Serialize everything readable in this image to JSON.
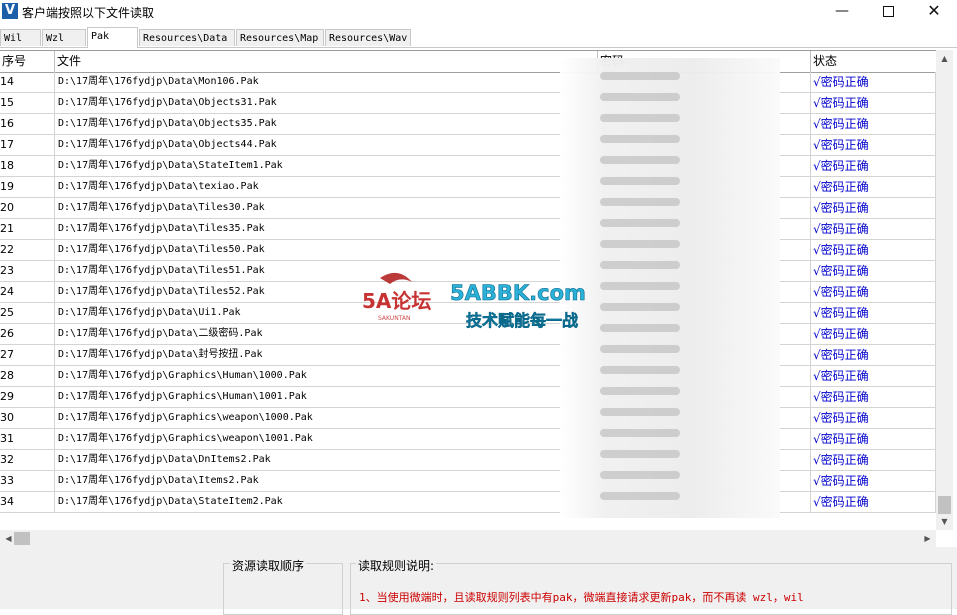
{
  "window": {
    "title": "客户端按照以下文件读取",
    "app_icon": "V",
    "min_icon": "minimize-icon",
    "max_icon": "maximize-icon",
    "close_icon": "close-icon"
  },
  "tabs": [
    {
      "label": "Wil"
    },
    {
      "label": "Wzl"
    },
    {
      "label": "Pak"
    },
    {
      "label": "Resources\\Data"
    },
    {
      "label": "Resources\\Map"
    },
    {
      "label": "Resources\\Wav"
    }
  ],
  "active_tab": "Pak",
  "table": {
    "headers": {
      "no": "序号",
      "file": "文件",
      "password": "密码",
      "status": "状态"
    },
    "rows": [
      {
        "no": "14",
        "file": "D:\\17周年\\176fydjp\\Data\\Mon106.Pak",
        "status": "√密码正确"
      },
      {
        "no": "15",
        "file": "D:\\17周年\\176fydjp\\Data\\Objects31.Pak",
        "status": "√密码正确"
      },
      {
        "no": "16",
        "file": "D:\\17周年\\176fydjp\\Data\\Objects35.Pak",
        "status": "√密码正确"
      },
      {
        "no": "17",
        "file": "D:\\17周年\\176fydjp\\Data\\Objects44.Pak",
        "status": "√密码正确"
      },
      {
        "no": "18",
        "file": "D:\\17周年\\176fydjp\\Data\\StateItem1.Pak",
        "status": "√密码正确"
      },
      {
        "no": "19",
        "file": "D:\\17周年\\176fydjp\\Data\\texiao.Pak",
        "status": "√密码正确"
      },
      {
        "no": "20",
        "file": "D:\\17周年\\176fydjp\\Data\\Tiles30.Pak",
        "status": "√密码正确"
      },
      {
        "no": "21",
        "file": "D:\\17周年\\176fydjp\\Data\\Tiles35.Pak",
        "status": "√密码正确"
      },
      {
        "no": "22",
        "file": "D:\\17周年\\176fydjp\\Data\\Tiles50.Pak",
        "status": "√密码正确"
      },
      {
        "no": "23",
        "file": "D:\\17周年\\176fydjp\\Data\\Tiles51.Pak",
        "status": "√密码正确"
      },
      {
        "no": "24",
        "file": "D:\\17周年\\176fydjp\\Data\\Tiles52.Pak",
        "status": "√密码正确"
      },
      {
        "no": "25",
        "file": "D:\\17周年\\176fydjp\\Data\\Ui1.Pak",
        "status": "√密码正确"
      },
      {
        "no": "26",
        "file": "D:\\17周年\\176fydjp\\Data\\二级密码.Pak",
        "status": "√密码正确"
      },
      {
        "no": "27",
        "file": "D:\\17周年\\176fydjp\\Data\\封号按扭.Pak",
        "status": "√密码正确"
      },
      {
        "no": "28",
        "file": "D:\\17周年\\176fydjp\\Graphics\\Human\\1000.Pak",
        "status": "√密码正确"
      },
      {
        "no": "29",
        "file": "D:\\17周年\\176fydjp\\Graphics\\Human\\1001.Pak",
        "status": "√密码正确"
      },
      {
        "no": "30",
        "file": "D:\\17周年\\176fydjp\\Graphics\\weapon\\1000.Pak",
        "status": "√密码正确"
      },
      {
        "no": "31",
        "file": "D:\\17周年\\176fydjp\\Graphics\\weapon\\1001.Pak",
        "status": "√密码正确"
      },
      {
        "no": "32",
        "file": "D:\\17周年\\176fydjp\\Data\\DnItems2.Pak",
        "status": "√密码正确"
      },
      {
        "no": "33",
        "file": "D:\\17周年\\176fydjp\\Data\\Items2.Pak",
        "status": "√密码正确"
      },
      {
        "no": "34",
        "file": "D:\\17周年\\176fydjp\\Data\\StateItem2.Pak",
        "status": "√密码正确"
      }
    ]
  },
  "bottom": {
    "order_title": "资源读取顺序",
    "rules_title": "读取规则说明:",
    "rule_1": "1、当使用微端时，且读取规则列表中有pak，微端直接请求更新pak，而不再读 wzl，wil"
  },
  "watermark": {
    "logo_text": "5A论坛",
    "site": "5ABBK.com",
    "slogan": "技术赋能每一战",
    "sub": "SAKUNTAN"
  },
  "colors": {
    "status_text": "#0000cc",
    "rule_text": "#cc0000",
    "app_icon_bg": "#1c5fa8"
  }
}
